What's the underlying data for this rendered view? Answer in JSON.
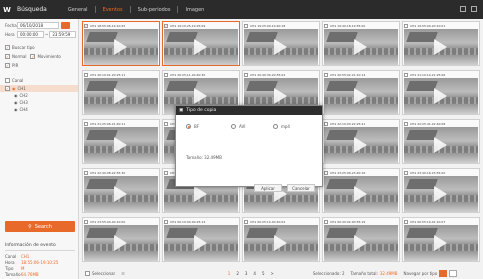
{
  "app": {
    "logo": "W",
    "title": "Búsqueda"
  },
  "tabs": [
    {
      "label": "General"
    },
    {
      "label": "Eventos"
    },
    {
      "label": "Sub-periodos"
    },
    {
      "label": "Imagen"
    }
  ],
  "filters": {
    "date_label": "Fecha",
    "date_value": "06/10/2018",
    "time_label": "Hora",
    "time_from": "00:00:00",
    "time_to": "23:59:59",
    "search_type_label": "Buscar tipo",
    "normal_label": "Normal",
    "movement_label": "Movimiento",
    "pir_label": "PIR",
    "channel_label": "Canal",
    "channels": [
      "CH1",
      "CH2",
      "CH3",
      "CH4"
    ]
  },
  "search_button": "Search",
  "event_info": {
    "title": "Información de evento",
    "rows": [
      {
        "k": "Canal",
        "v": "CH1"
      },
      {
        "k": "Hora",
        "v": "18:55:06-19:10:25"
      },
      {
        "k": "Tipo",
        "v": "M"
      },
      {
        "k": "Tamaño",
        "v": "64.76MB"
      }
    ]
  },
  "cells": [
    {
      "label": "CH1  18:55:06-19:10:25"
    },
    {
      "label": "CH1  19:10:25-19:25:09"
    },
    {
      "label": "CH1  19:25:09-19:40:18"
    },
    {
      "label": "CH1  19:40:18-19:55:00"
    },
    {
      "label": "CH1  19:55:00-20:10:01"
    },
    {
      "label": "CH1  20:10:01-20:25:11"
    },
    {
      "label": "CH1  20:25:11-20:40:30"
    },
    {
      "label": "CH1  20:40:30-20:55:02"
    },
    {
      "label": "CH1  20:55:02-21:10:14"
    },
    {
      "label": "CH1  21:10:14-21:25:06"
    },
    {
      "label": "CH1  21:25:06-21:40:11"
    },
    {
      "label": "CH1  21:40:11-21:55:20"
    },
    {
      "label": "CH1  21:55:20-22:10:03"
    },
    {
      "label": "CH1  22:10:03-22:25:41"
    },
    {
      "label": "CH1  22:25:41-22:40:08"
    },
    {
      "label": "CH1  22:40:08-22:55:30"
    },
    {
      "label": "CH1  22:55:30-23:10:12"
    },
    {
      "label": "CH1  23:10:12-23:25:09"
    },
    {
      "label": "CH1  23:25:09-23:40:16"
    },
    {
      "label": "CH1  23:40:16-23:55:00"
    },
    {
      "label": "CH1  23:55:00-00:10:00"
    },
    {
      "label": "CH1  00:10:00-00:25:14"
    },
    {
      "label": "CH1  00:25:14-00:40:02"
    },
    {
      "label": "CH1  00:40:02-00:55:19"
    },
    {
      "label": "CH1  00:55:19-01:10:07"
    }
  ],
  "bottom": {
    "select_all": "Seleccionar",
    "pages": [
      "1",
      "2",
      "3",
      "4",
      "5"
    ],
    "next": ">",
    "selected_label": "Seleccionado: 2",
    "total_label": "Tamaño total:",
    "total_value": "32.49MB",
    "nav_label": "Navegar por tipo"
  },
  "dialog": {
    "title": "Tipo de copia",
    "options": [
      "BF",
      "AVI",
      "mp4"
    ],
    "size_label": "Tamaño: 32.49MB",
    "ok": "Aplicar",
    "cancel": "Cancelar"
  },
  "colors": {
    "accent": "#e86a2a"
  }
}
